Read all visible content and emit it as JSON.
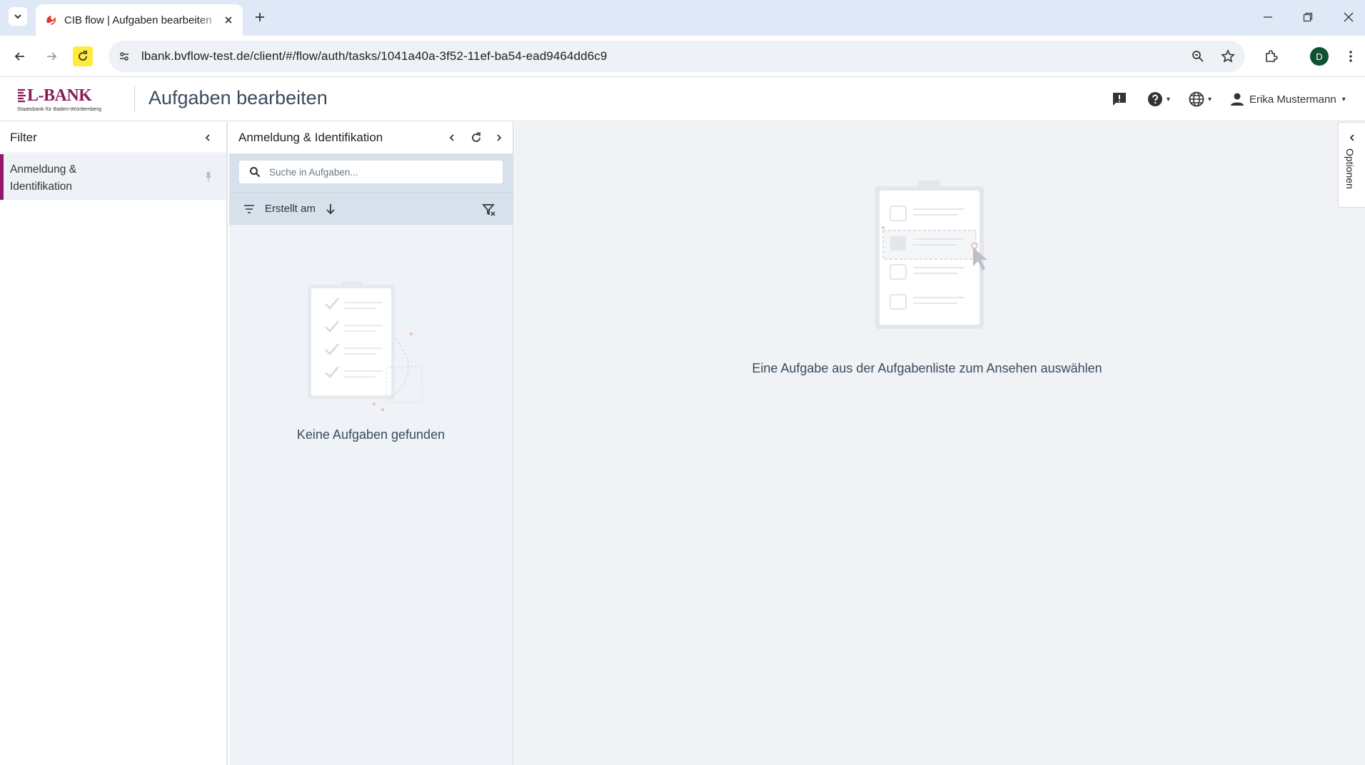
{
  "browser": {
    "tab_title": "CIB flow | Aufgaben bearbeiten",
    "url": "lbank.bvflow-test.de/client/#/flow/auth/tasks/1041a40a-3f52-11ef-ba54-ead9464dd6c9",
    "profile_initial": "D",
    "reload_highlight_color": "#ffeb3b"
  },
  "header": {
    "logo_text": "L-BANK",
    "logo_subtitle": "Staatsbank für Baden-Württemberg",
    "page_title": "Aufgaben bearbeiten",
    "user_name": "Erika Mustermann",
    "brand_color": "#8a1a54"
  },
  "filter_panel": {
    "title": "Filter",
    "items": [
      {
        "label": "Anmeldung & Identifikation"
      }
    ],
    "active_accent_color": "#96176b"
  },
  "tasks_panel": {
    "title": "Anmeldung & Identifikation",
    "search_placeholder": "Suche in Aufgaben...",
    "sort_label": "Erstellt am",
    "empty_message": "Keine Aufgaben gefunden"
  },
  "main": {
    "empty_message": "Eine Aufgabe aus der Aufgabenliste zum Ansehen auswählen",
    "options_label": "Optionen"
  }
}
